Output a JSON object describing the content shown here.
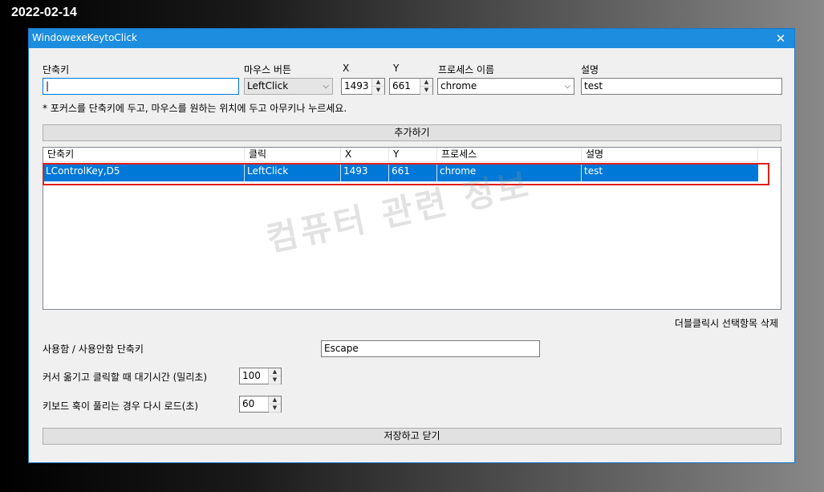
{
  "desktop": {
    "date": "2022-02-14"
  },
  "window": {
    "title": "WindowexeKeytoClick",
    "close_glyph": "✕"
  },
  "form": {
    "hotkey_label": "단축키",
    "hotkey_value": "|",
    "mouse_button_label": "마우스 버튼",
    "mouse_button_value": "LeftClick",
    "x_label": "X",
    "x_value": "1493",
    "y_label": "Y",
    "y_value": "661",
    "process_label": "프로세스 이름",
    "process_value": "chrome",
    "desc_label": "설명",
    "desc_value": "test",
    "hint": "* 포커스를 단축키에 두고, 마우스를 원하는 위치에 두고 아무키나 누르세요.",
    "add_button": "추가하기"
  },
  "list": {
    "columns": [
      "단축키",
      "클릭",
      "X",
      "Y",
      "프로세스",
      "설명"
    ],
    "rows": [
      {
        "hotkey": "LControlKey,D5",
        "click": "LeftClick",
        "x": "1493",
        "y": "661",
        "process": "chrome",
        "desc": "test"
      }
    ],
    "watermark": "컴퓨터 관련 정보",
    "delete_hint": "더블클릭시 선택항목 삭제"
  },
  "settings": {
    "toggle_label": "사용함 / 사용안함 단축키",
    "toggle_value": "Escape",
    "wait_label": "커서 옮기고 클릭할 때 대기시간 (밀리초)",
    "wait_value": "100",
    "reload_label": "키보드 훅이 풀리는 경우 다시 로드(초)",
    "reload_value": "60"
  },
  "save_button": "저장하고 닫기",
  "icons": {
    "dropdown": "chevron-down-icon",
    "spin_up": "spin-up-icon",
    "spin_down": "spin-down-icon"
  },
  "colors": {
    "titlebar": "#1c8ddf",
    "selection": "#0078d7",
    "highlight": "#e0201b"
  }
}
